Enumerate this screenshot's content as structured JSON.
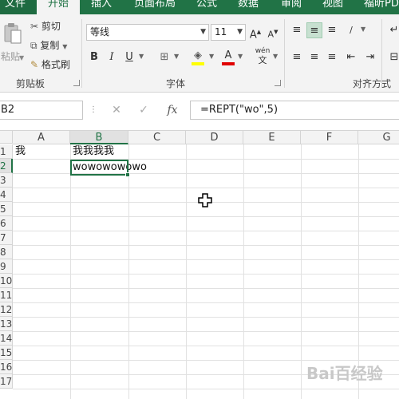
{
  "tabs": [
    {
      "label": "文件"
    },
    {
      "label": "开始"
    },
    {
      "label": "插入"
    },
    {
      "label": "页面布局"
    },
    {
      "label": "公式"
    },
    {
      "label": "数据"
    },
    {
      "label": "审阅"
    },
    {
      "label": "视图"
    },
    {
      "label": "福昕PDF"
    }
  ],
  "clipboard": {
    "paste_label": "粘贴",
    "cut_label": "剪切",
    "copy_label": "复制",
    "format_painter_label": "格式刷",
    "group_label": "剪贴板"
  },
  "font": {
    "name": "等线",
    "size": "11",
    "grow": "A",
    "shrink": "A",
    "bold": "B",
    "italic": "I",
    "underline": "U",
    "font_color_letter": "A",
    "phonetic": "wén",
    "group_label": "字体"
  },
  "alignment": {
    "group_label": "对齐方式"
  },
  "formula_bar": {
    "name_box": "B2",
    "cancel": "✕",
    "enter": "✓",
    "fx": "fx",
    "formula": "=REPT(\"wo\",5)"
  },
  "columns": [
    "A",
    "B",
    "C",
    "D",
    "E",
    "F",
    "G"
  ],
  "rows": [
    "1",
    "2",
    "3",
    "4",
    "5",
    "6",
    "7",
    "8",
    "9",
    "10",
    "11",
    "12",
    "13",
    "14",
    "15",
    "16",
    "17"
  ],
  "cells": {
    "A1": "我",
    "B1": "我我我我",
    "B2": "wowowowowo"
  },
  "active_cell": "B2",
  "watermark": "Bai百经验",
  "colors": {
    "ribbon_green": "#217346",
    "ribbon_bg": "#f3f3f3",
    "selected_button": "#c7e0d0"
  }
}
